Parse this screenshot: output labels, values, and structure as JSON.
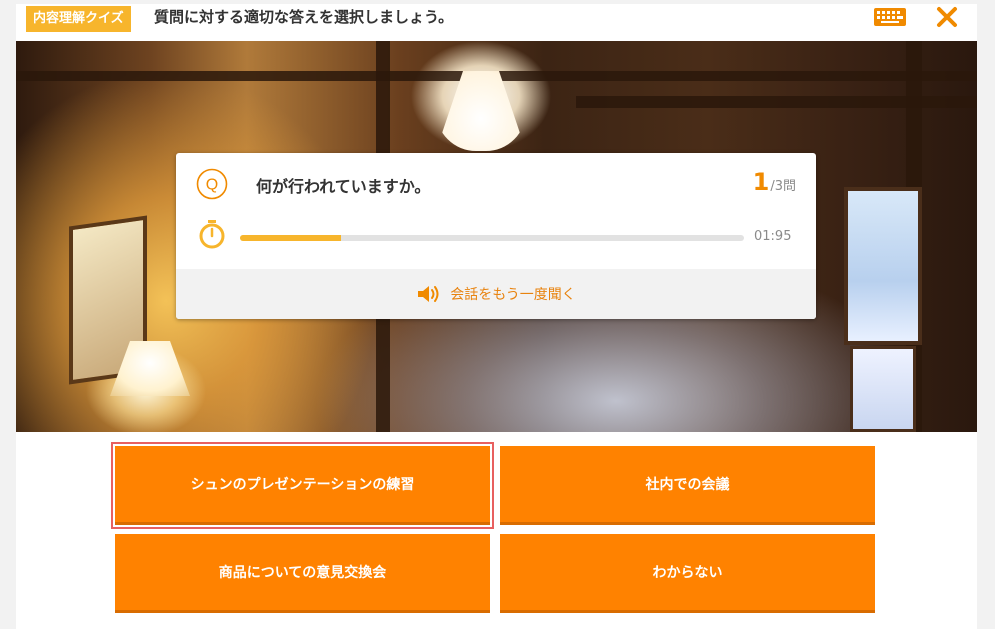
{
  "header": {
    "tag": "内容理解クイズ",
    "instruction": "質問に対する適切な答えを選択しましょう。",
    "keyboard_icon": "keyboard-icon",
    "close_icon": "close-icon"
  },
  "question": {
    "q_mark": "Q",
    "text": "何が行われていますか。",
    "current": "1",
    "total": "/3問",
    "progress_fraction": 0.2,
    "time_left": "01:95",
    "replay_label": "会話をもう一度聞く",
    "replay_icon": "speaker-icon",
    "timer_icon": "stopwatch-icon"
  },
  "answers": [
    {
      "label": "シュンのプレゼンテーションの練習",
      "selected": true
    },
    {
      "label": "社内での会議",
      "selected": false
    },
    {
      "label": "商品についての意見交換会",
      "selected": false
    },
    {
      "label": "わからない",
      "selected": false
    }
  ],
  "colors": {
    "accent": "#ff8200",
    "tag_bg": "#f7b52c",
    "progress": "#f7b52c",
    "selected_outline": "#e86060"
  }
}
